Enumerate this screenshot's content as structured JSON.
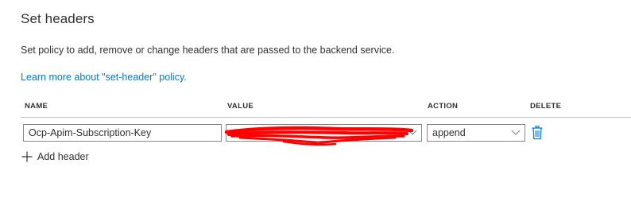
{
  "panel": {
    "title": "Set headers",
    "description": "Set policy to add, remove or change headers that are passed to the backend service.",
    "learn_more_link": "Learn more about \"set-header\" policy."
  },
  "table": {
    "columns": {
      "name": "NAME",
      "value": "VALUE",
      "action": "ACTION",
      "delete": "DELETE"
    },
    "rows": [
      {
        "name": "Ocp-Apim-Subscription-Key",
        "value_redacted": true,
        "action": "append"
      }
    ]
  },
  "add_header_label": "Add header",
  "icons": {
    "dropdown": "chevron-down-icon",
    "delete": "trash-icon",
    "add": "plus-icon"
  },
  "colors": {
    "link": "#0078d4",
    "text": "#323130",
    "border": "#8a8886",
    "divider": "#c8c6c4",
    "redaction": "#ff0000"
  }
}
